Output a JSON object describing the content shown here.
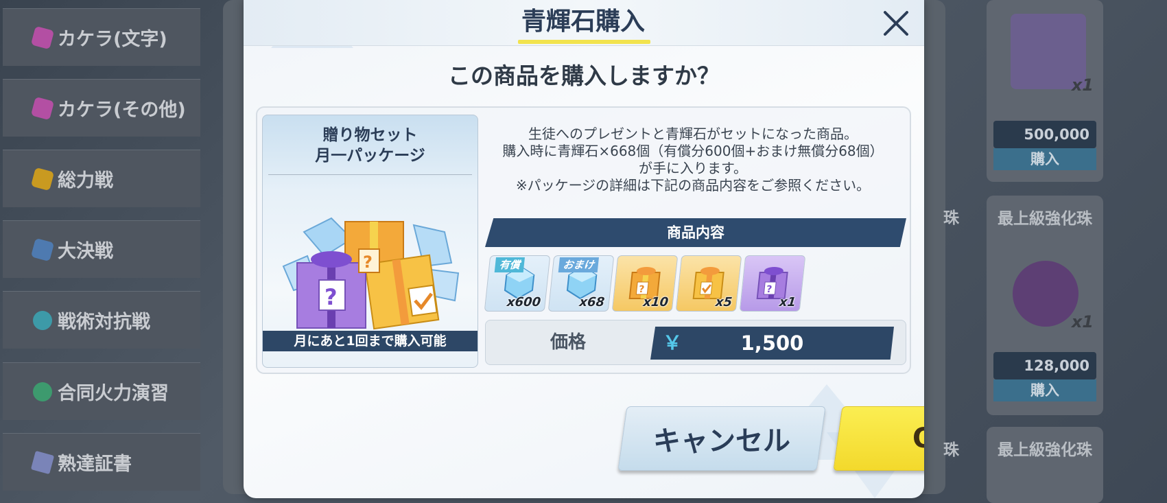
{
  "background": {
    "sidebar_items": [
      {
        "label": "カケラ(文字)",
        "icon": "fragment-icon",
        "color": "#b34fa3"
      },
      {
        "label": "カケラ(その他)",
        "icon": "fragment-icon",
        "color": "#b34fa3"
      },
      {
        "label": "総力戦",
        "icon": "raid-icon",
        "color": "#c99a20"
      },
      {
        "label": "大決戦",
        "icon": "grand-assault-icon",
        "color": "#4e7ab0"
      },
      {
        "label": "戦術対抗戦",
        "icon": "tactical-challenge-icon",
        "color": "#3d9aa8"
      },
      {
        "label": "合同火力演習",
        "icon": "joint-exercise-icon",
        "color": "#3d9a6e"
      },
      {
        "label": "熟達証書",
        "icon": "certificate-icon",
        "color": "#7a84b8"
      }
    ],
    "shop_cards": [
      {
        "count": "x1",
        "price": "500,000",
        "buy_label": "購入"
      },
      {
        "title": "最上級強化珠",
        "count": "x1",
        "price": "128,000",
        "buy_label": "購入"
      },
      {
        "title": "最上級強化珠"
      }
    ],
    "partial_labels": [
      "珠",
      "珠"
    ]
  },
  "modal": {
    "title": "青輝石購入",
    "question": "この商品を購入しますか？",
    "package": {
      "name_line1": "贈り物セット",
      "name_line2": "月一パッケージ",
      "purchase_limit": "月にあと1回まで購入可能"
    },
    "description": [
      "生徒へのプレゼントと青輝石がセットになった商品。",
      "購入時に青輝石×668個（有償分600個+おまけ無償分68個）",
      "が手に入ります。",
      "※パッケージの詳細は下記の商品内容をご参照ください。"
    ],
    "contents_header": "商品内容",
    "items": [
      {
        "tag": "有償",
        "count": "x600",
        "icon": "pyroxene-icon"
      },
      {
        "tag": "おまけ",
        "count": "x68",
        "icon": "pyroxene-icon"
      },
      {
        "tag": "",
        "count": "x10",
        "icon": "gold-gift-box-icon"
      },
      {
        "tag": "",
        "count": "x5",
        "icon": "gold-gift-box-icon"
      },
      {
        "tag": "",
        "count": "x1",
        "icon": "purple-gift-box-icon"
      }
    ],
    "price": {
      "label": "価格",
      "currency": "￥",
      "value": "1,500"
    },
    "cancel_label": "キャンセル",
    "ok_label": "OK"
  },
  "colors": {
    "title_text": "#2b3d57",
    "accent_yellow": "#f2e34e",
    "navy_bar": "#2e4b6e",
    "ok_button": "#f6e03c",
    "cancel_button": "#d2e4f0"
  }
}
